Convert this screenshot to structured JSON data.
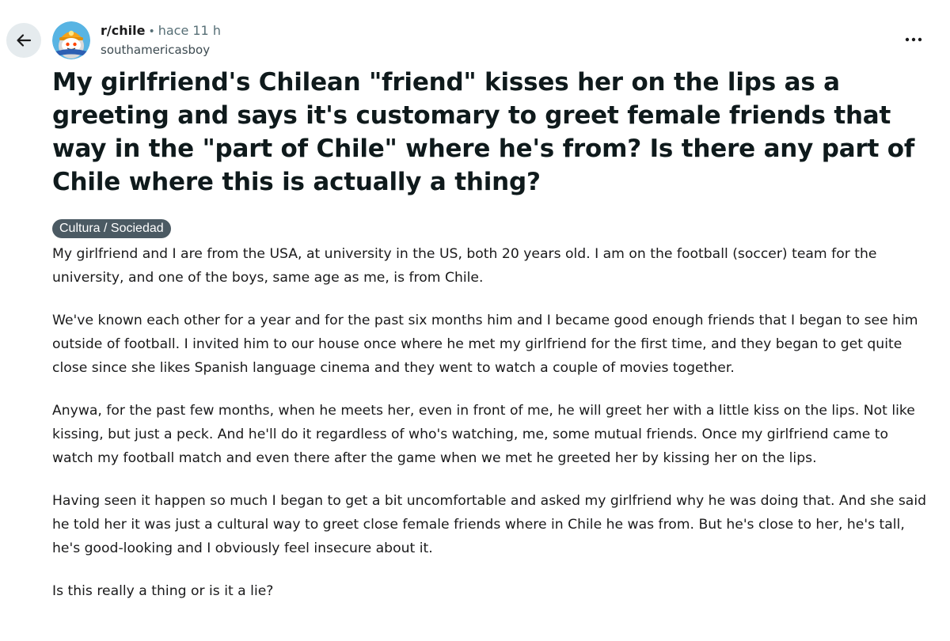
{
  "header": {
    "subreddit": "r/chile",
    "separator": "•",
    "timestamp": "hace 11 h",
    "username": "southamericasboy"
  },
  "icons": {
    "back": "arrow-left-icon",
    "more": "more-horizontal-icon",
    "avatar": "subreddit-avatar"
  },
  "post": {
    "title": "My girlfriend's Chilean \"friend\" kisses her on the lips as a greeting and says it's customary to greet female friends that way in the \"part of Chile\" where he's from? Is there any part of Chile where this is actually a thing?",
    "flair": "Cultura / Sociedad",
    "paragraphs": [
      "My girlfriend and I are from the USA, at university in the US, both 20 years old. I am on the football (soccer) team for the university, and one of the boys, same age as me, is from Chile.",
      "We've known each other for a year and for the past six months him and I became good enough friends that I began to see him outside of football. I invited him to our house once where he met my girlfriend for the first time, and they began to get quite close since she likes Spanish language cinema and they went to watch a couple of movies together.",
      "Anywa, for the past few months, when he meets her, even in front of me, he will greet her with a little kiss on the lips. Not like kissing, but just a peck. And he'll do it regardless of who's watching, me, some mutual friends. Once my girlfriend came to watch my football match and even there after the game when we met he greeted her by kissing her on the lips.",
      "Having seen it happen so much I began to get a bit uncomfortable and asked my girlfriend why he was doing that. And she said he told her it was just a cultural way to greet close female friends where in Chile he was from. But he's close to her, he's tall, he's good-looking and I obviously feel insecure about it.",
      "Is this really a thing or is it a lie?"
    ]
  },
  "colors": {
    "flair_bg": "#4b5a63",
    "back_button_bg": "#e5ebee",
    "meta_gray": "#576f76"
  }
}
